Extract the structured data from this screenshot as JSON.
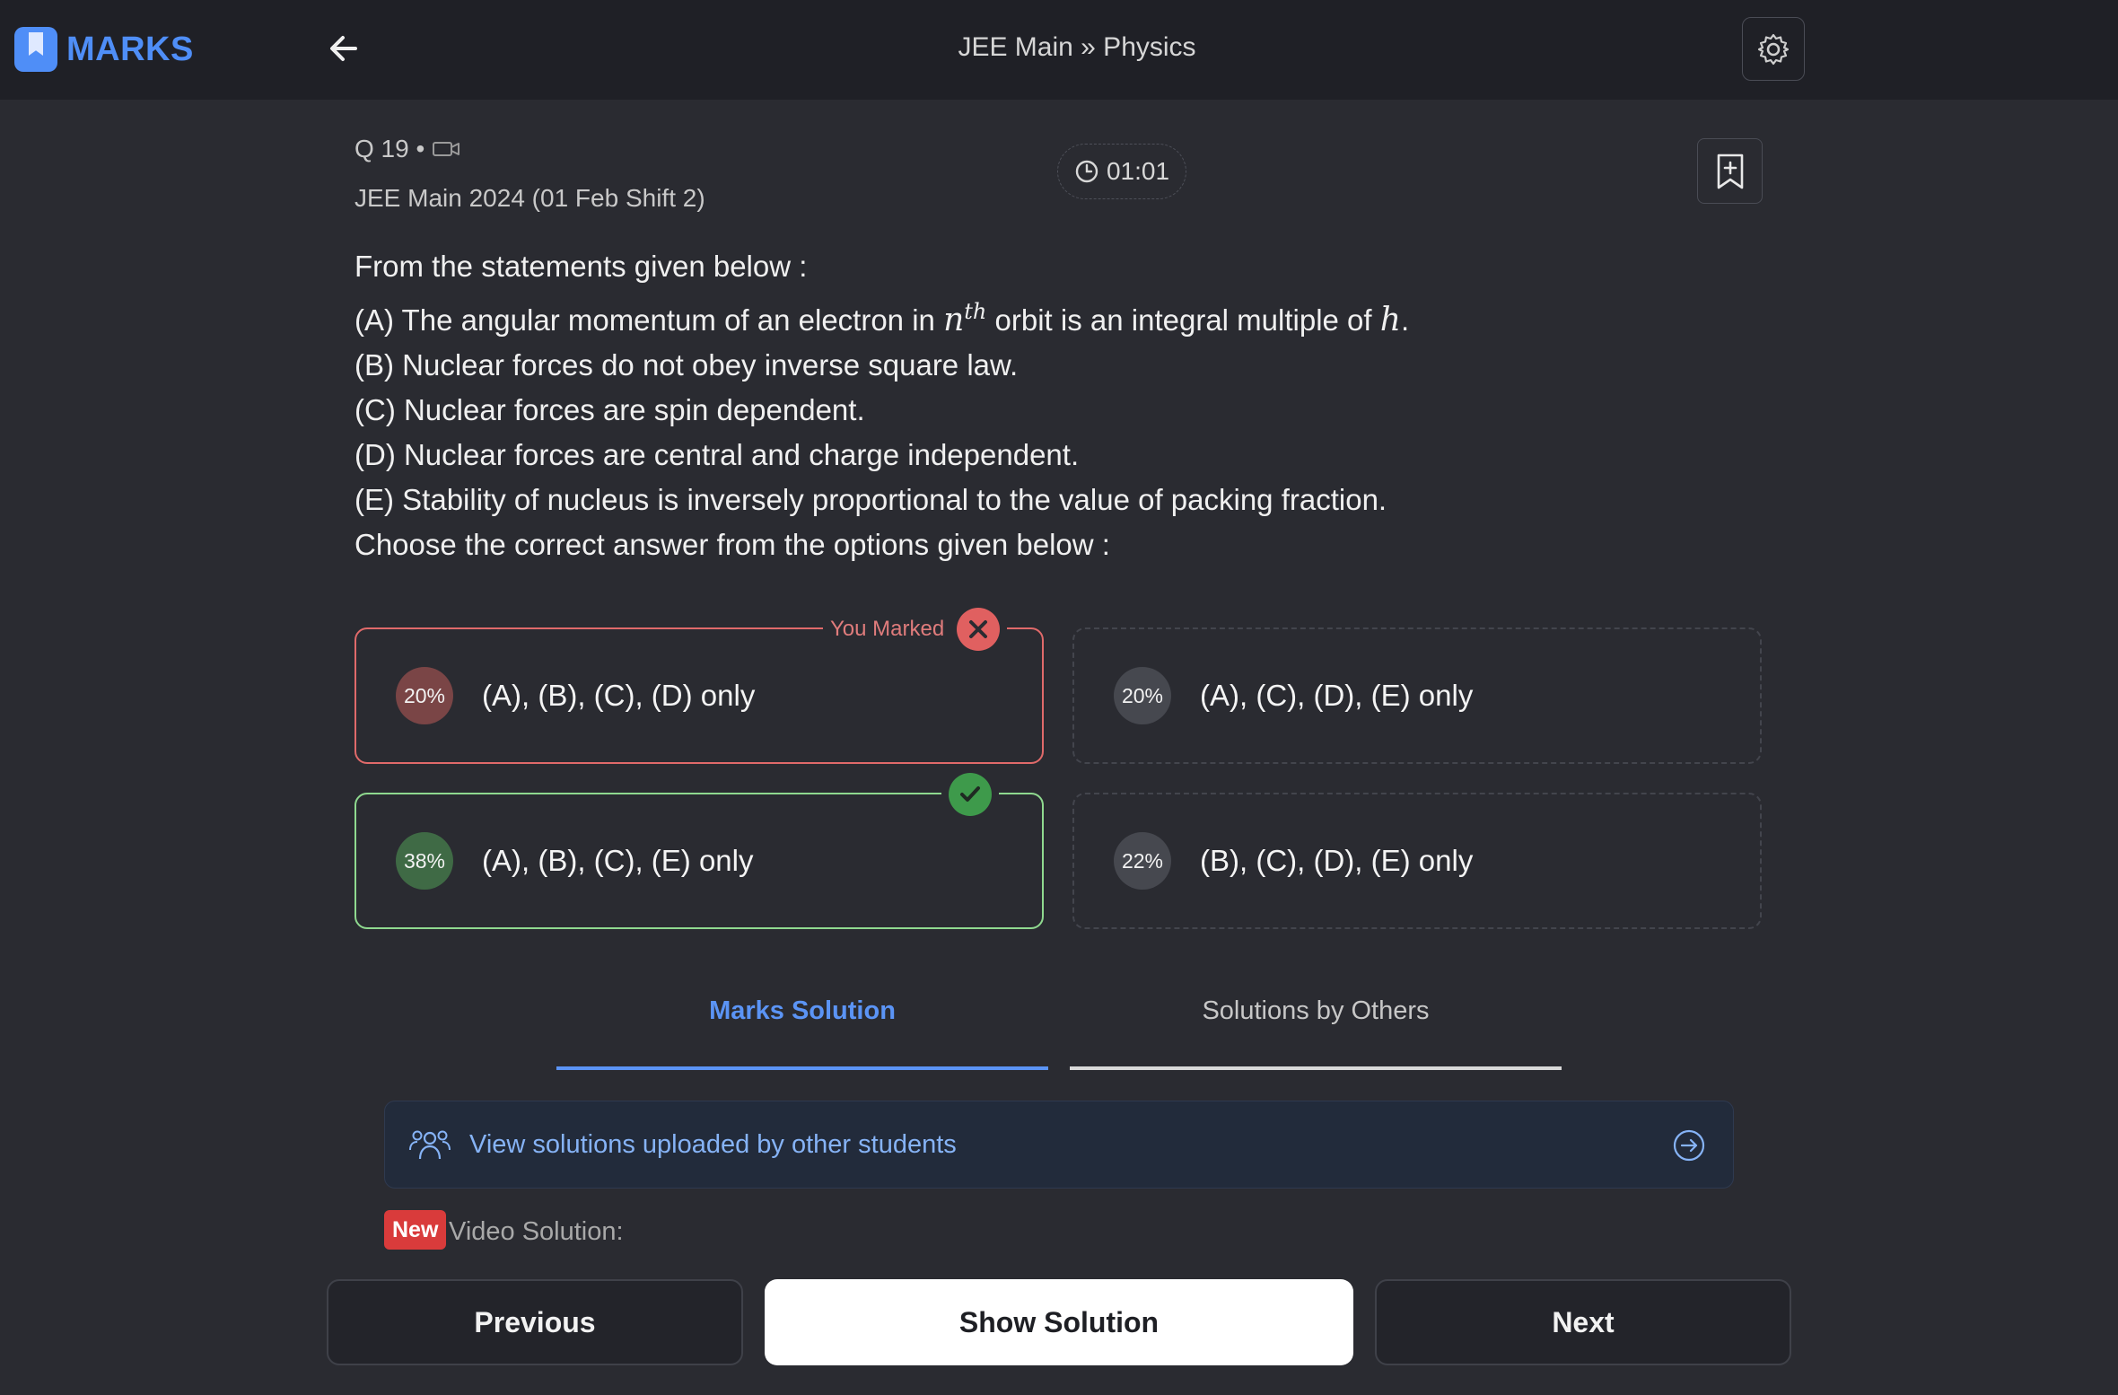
{
  "app": {
    "name": "MARKS"
  },
  "header": {
    "breadcrumb": "JEE Main » Physics"
  },
  "question": {
    "number": "Q 19 •",
    "source": "JEE Main 2024 (01 Feb Shift 2)",
    "timer": "01:01",
    "lines": [
      "From the statements given below :",
      "(A) The angular momentum of an electron in",
      "orbit is an integral multiple of",
      "(B) Nuclear forces do not obey inverse square law.",
      "(C) Nuclear forces are spin dependent.",
      "(D) Nuclear forces are central and charge independent.",
      "(E) Stability of nucleus is inversely proportional to the value of packing fraction.",
      "Choose the correct answer from the options given below :"
    ],
    "math_n": "n",
    "math_sup": "th",
    "math_h": "h",
    "period": "."
  },
  "options": [
    {
      "percent": "20%",
      "text": "(A), (B), (C), (D) only",
      "status": "you-marked-wrong"
    },
    {
      "percent": "20%",
      "text": "(A), (C), (D), (E) only",
      "status": "none"
    },
    {
      "percent": "38%",
      "text": "(A), (B), (C), (E) only",
      "status": "correct"
    },
    {
      "percent": "22%",
      "text": "(B), (C), (D), (E) only",
      "status": "none"
    }
  ],
  "marked_label": "You Marked",
  "tabs": [
    {
      "label": "Marks Solution",
      "active": true
    },
    {
      "label": "Solutions by Others",
      "active": false
    }
  ],
  "banner": {
    "text": "View solutions uploaded by other students"
  },
  "video": {
    "badge": "New",
    "label": "Video Solution:"
  },
  "footer": {
    "previous": "Previous",
    "show_solution": "Show Solution",
    "next": "Next"
  },
  "colors": {
    "accent": "#5b94f5",
    "wrong": "#e06060",
    "correct": "#3e9a4b",
    "background": "#2a2b31"
  },
  "icons": [
    "logo-icon",
    "back-arrow-icon",
    "settings-gear-icon",
    "video-camera-icon",
    "clock-icon",
    "bookmark-add-icon",
    "close-x-icon",
    "check-icon",
    "users-group-icon",
    "arrow-circle-right-icon"
  ]
}
